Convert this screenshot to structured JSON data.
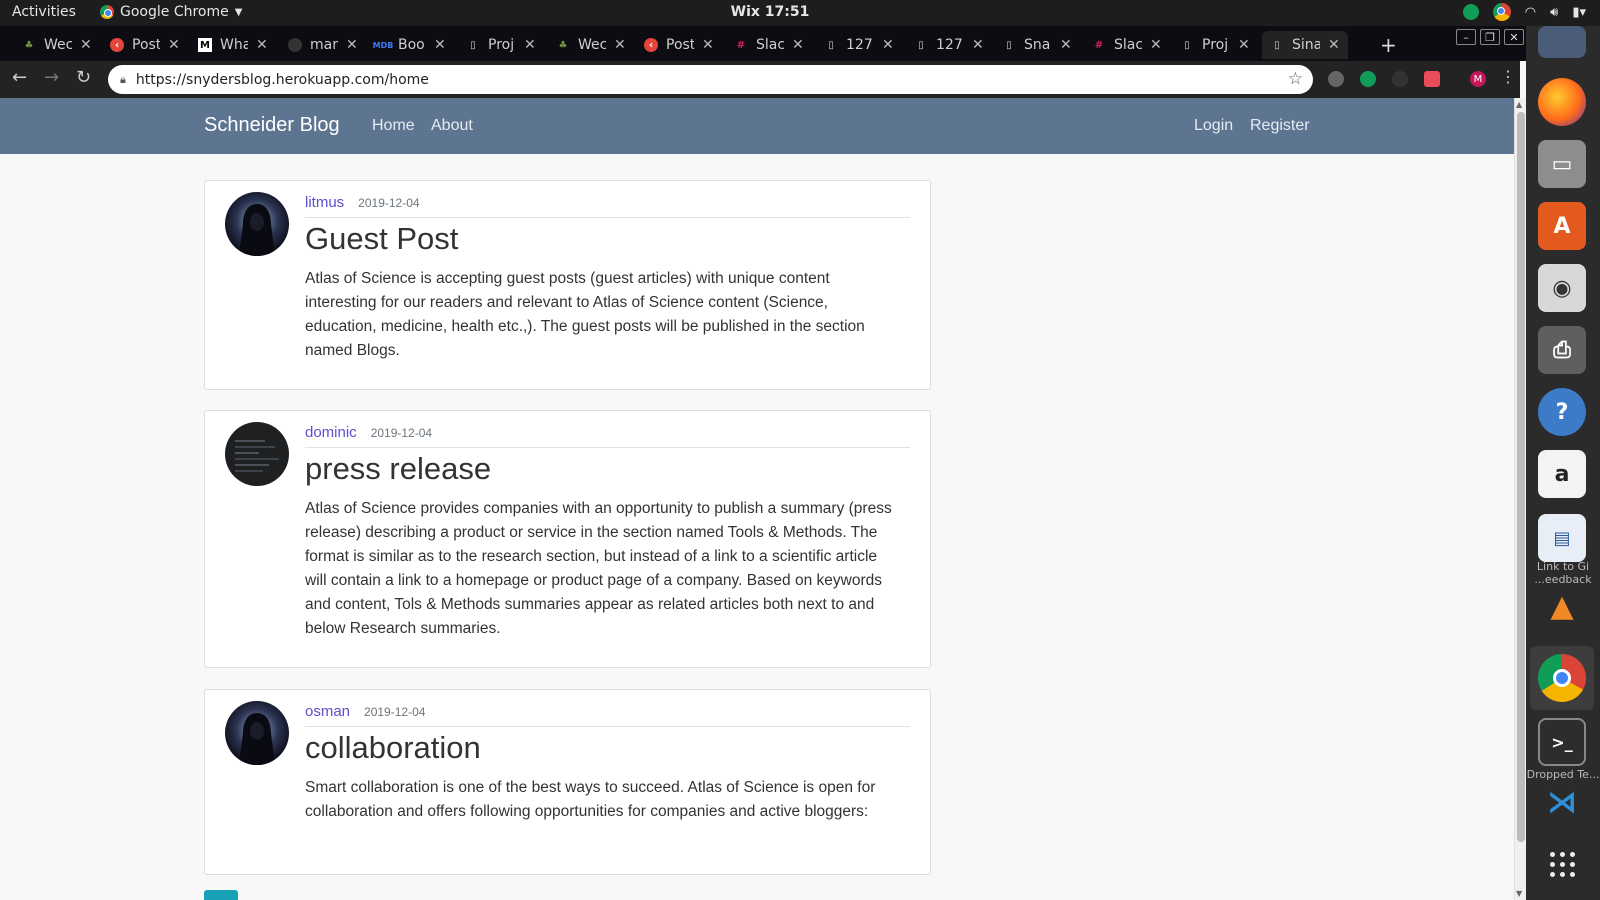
{
  "system": {
    "activities": "Activities",
    "app_name": "Google Chrome",
    "clock": "Wix 17:51"
  },
  "browser": {
    "tabs": [
      {
        "title": "Wec",
        "icon": "palm-icon"
      },
      {
        "title": "Post",
        "icon": "red-circle-icon"
      },
      {
        "title": "Wha",
        "icon": "m-icon"
      },
      {
        "title": "mar",
        "icon": "github-icon"
      },
      {
        "title": "Boo",
        "icon": "mdb-icon"
      },
      {
        "title": "Proj",
        "icon": "page-icon"
      },
      {
        "title": "Wec",
        "icon": "palm-icon"
      },
      {
        "title": "Post",
        "icon": "red-circle-icon"
      },
      {
        "title": "Slac",
        "icon": "slack-icon"
      },
      {
        "title": "127.",
        "icon": "page-icon"
      },
      {
        "title": "127.",
        "icon": "page-icon"
      },
      {
        "title": "Sna",
        "icon": "page-icon"
      },
      {
        "title": "Slac",
        "icon": "slack-icon"
      },
      {
        "title": "Proj",
        "icon": "page-icon"
      },
      {
        "title": "Sina",
        "icon": "page-icon"
      }
    ],
    "active_tab": 14,
    "url": "https://snydersblog.herokuapp.com/home"
  },
  "navbar": {
    "brand": "Schneider Blog",
    "links": [
      "Home",
      "About"
    ],
    "login": "Login",
    "register": "Register",
    "color": "#5e7591"
  },
  "posts": [
    {
      "author": "litmus",
      "date": "2019-12-04",
      "title": "Guest Post",
      "body": "Atlas of Science is accepting guest posts (guest articles) with unique content interesting for our readers and relevant to Atlas of Science content (Science, education, medicine, health etc.,). The guest posts will be published in the section named Blogs."
    },
    {
      "author": "dominic",
      "date": "2019-12-04",
      "title": "press release",
      "body": "Atlas of Science provides companies with an opportunity to publish a summary (press release) describing a product or service in the section named Tools & Methods. The format is similar as to the research section, but instead of a link to a scientific article will contain a link to a homepage or product page of a company. Based on keywords and content, Tols & Methods summaries appear as related articles both next to and below Research summaries."
    },
    {
      "author": "osman",
      "date": "2019-12-04",
      "title": "collaboration",
      "body": "Smart collaboration is one of the best ways to succeed. Atlas of Science is open for collaboration and offers following opportunities for companies and active bloggers:"
    }
  ],
  "dock": {
    "labels": [
      "Link to Gi ...eedback",
      "Dropped Te..."
    ]
  }
}
